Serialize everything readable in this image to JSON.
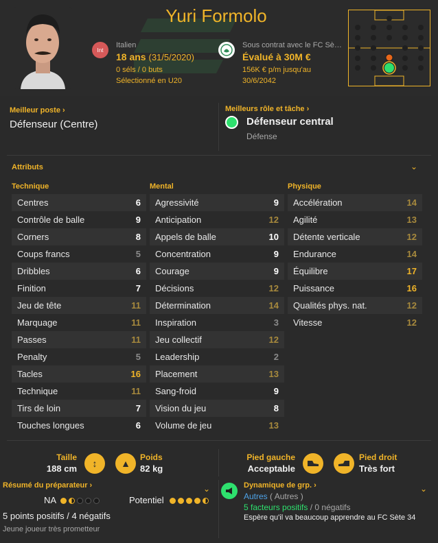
{
  "player": {
    "name": "Yuri Formolo",
    "nationality_code": "Int",
    "nationality": "Italien",
    "age": "18 ans",
    "birthdate": "(31/5/2020)",
    "caps": "0 séls / 0 buts",
    "selection": "Sélectionné en U20",
    "contract": "Sous contrat avec le FC Sè…",
    "value": "Évalué à 30M €",
    "wage": "156K € p/m jusqu'au",
    "contract_end": "30/6/2042"
  },
  "best_position": {
    "label": "Meilleur poste",
    "value": "Défenseur (Centre)"
  },
  "best_role": {
    "label": "Meilleurs rôle et tâche",
    "role": "Défenseur central",
    "duty": "Défense",
    "duty_color": "#2ee06e"
  },
  "attributes": {
    "title": "Attributs",
    "technique": {
      "title": "Technique",
      "items": [
        {
          "name": "Centres",
          "value": "6"
        },
        {
          "name": "Contrôle de balle",
          "value": "9"
        },
        {
          "name": "Corners",
          "value": "8"
        },
        {
          "name": "Coups francs",
          "value": "5"
        },
        {
          "name": "Dribbles",
          "value": "6"
        },
        {
          "name": "Finition",
          "value": "7"
        },
        {
          "name": "Jeu de tête",
          "value": "11"
        },
        {
          "name": "Marquage",
          "value": "11"
        },
        {
          "name": "Passes",
          "value": "11"
        },
        {
          "name": "Penalty",
          "value": "5"
        },
        {
          "name": "Tacles",
          "value": "16"
        },
        {
          "name": "Technique",
          "value": "11"
        },
        {
          "name": "Tirs de loin",
          "value": "7"
        },
        {
          "name": "Touches longues",
          "value": "6"
        }
      ]
    },
    "mental": {
      "title": "Mental",
      "items": [
        {
          "name": "Agressivité",
          "value": "9"
        },
        {
          "name": "Anticipation",
          "value": "12"
        },
        {
          "name": "Appels de balle",
          "value": "10"
        },
        {
          "name": "Concentration",
          "value": "9"
        },
        {
          "name": "Courage",
          "value": "9"
        },
        {
          "name": "Décisions",
          "value": "12"
        },
        {
          "name": "Détermination",
          "value": "14"
        },
        {
          "name": "Inspiration",
          "value": "3"
        },
        {
          "name": "Jeu collectif",
          "value": "12"
        },
        {
          "name": "Leadership",
          "value": "2"
        },
        {
          "name": "Placement",
          "value": "13"
        },
        {
          "name": "Sang-froid",
          "value": "9"
        },
        {
          "name": "Vision du jeu",
          "value": "8"
        },
        {
          "name": "Volume de jeu",
          "value": "13"
        }
      ]
    },
    "physique": {
      "title": "Physique",
      "items": [
        {
          "name": "Accélération",
          "value": "14"
        },
        {
          "name": "Agilité",
          "value": "13"
        },
        {
          "name": "Détente verticale",
          "value": "12"
        },
        {
          "name": "Endurance",
          "value": "14"
        },
        {
          "name": "Équilibre",
          "value": "17"
        },
        {
          "name": "Puissance",
          "value": "16"
        },
        {
          "name": "Qualités phys. nat.",
          "value": "12"
        },
        {
          "name": "Vitesse",
          "value": "12"
        }
      ]
    }
  },
  "value_colors": {
    "low": "#8a8a8a",
    "mid": "#ffffff",
    "good": "#a88a3d",
    "high": "#f0b429"
  },
  "physical": {
    "height_label": "Taille",
    "height": "188 cm",
    "weight_label": "Poids",
    "weight": "82 kg",
    "left_foot_label": "Pied gauche",
    "left_foot": "Acceptable",
    "right_foot_label": "Pied droit",
    "right_foot": "Très fort"
  },
  "coach_report": {
    "title": "Résumé du préparateur",
    "ca_label": "NA",
    "ca_stars": 1.5,
    "pa_label": "Potentiel",
    "pa_stars": 4.5,
    "summary": "5 points positifs / 4 négatifs",
    "note": "Jeune joueur très prometteur"
  },
  "dynamics": {
    "title": "Dynamique de grp.",
    "group": "Autres",
    "group_paren": "( Autres )",
    "positives": "5 facteurs positifs",
    "sep": "/",
    "negatives": "0 négatifs",
    "note": "Espère qu'il va beaucoup apprendre au FC Sète 34"
  },
  "icons": {
    "flag": "italy-flag-icon",
    "club": "club-crest-icon",
    "height": "height-icon",
    "weight": "weight-icon",
    "boot": "boot-icon",
    "dynamics": "megaphone-icon",
    "chevron": "chevron-down-icon"
  }
}
